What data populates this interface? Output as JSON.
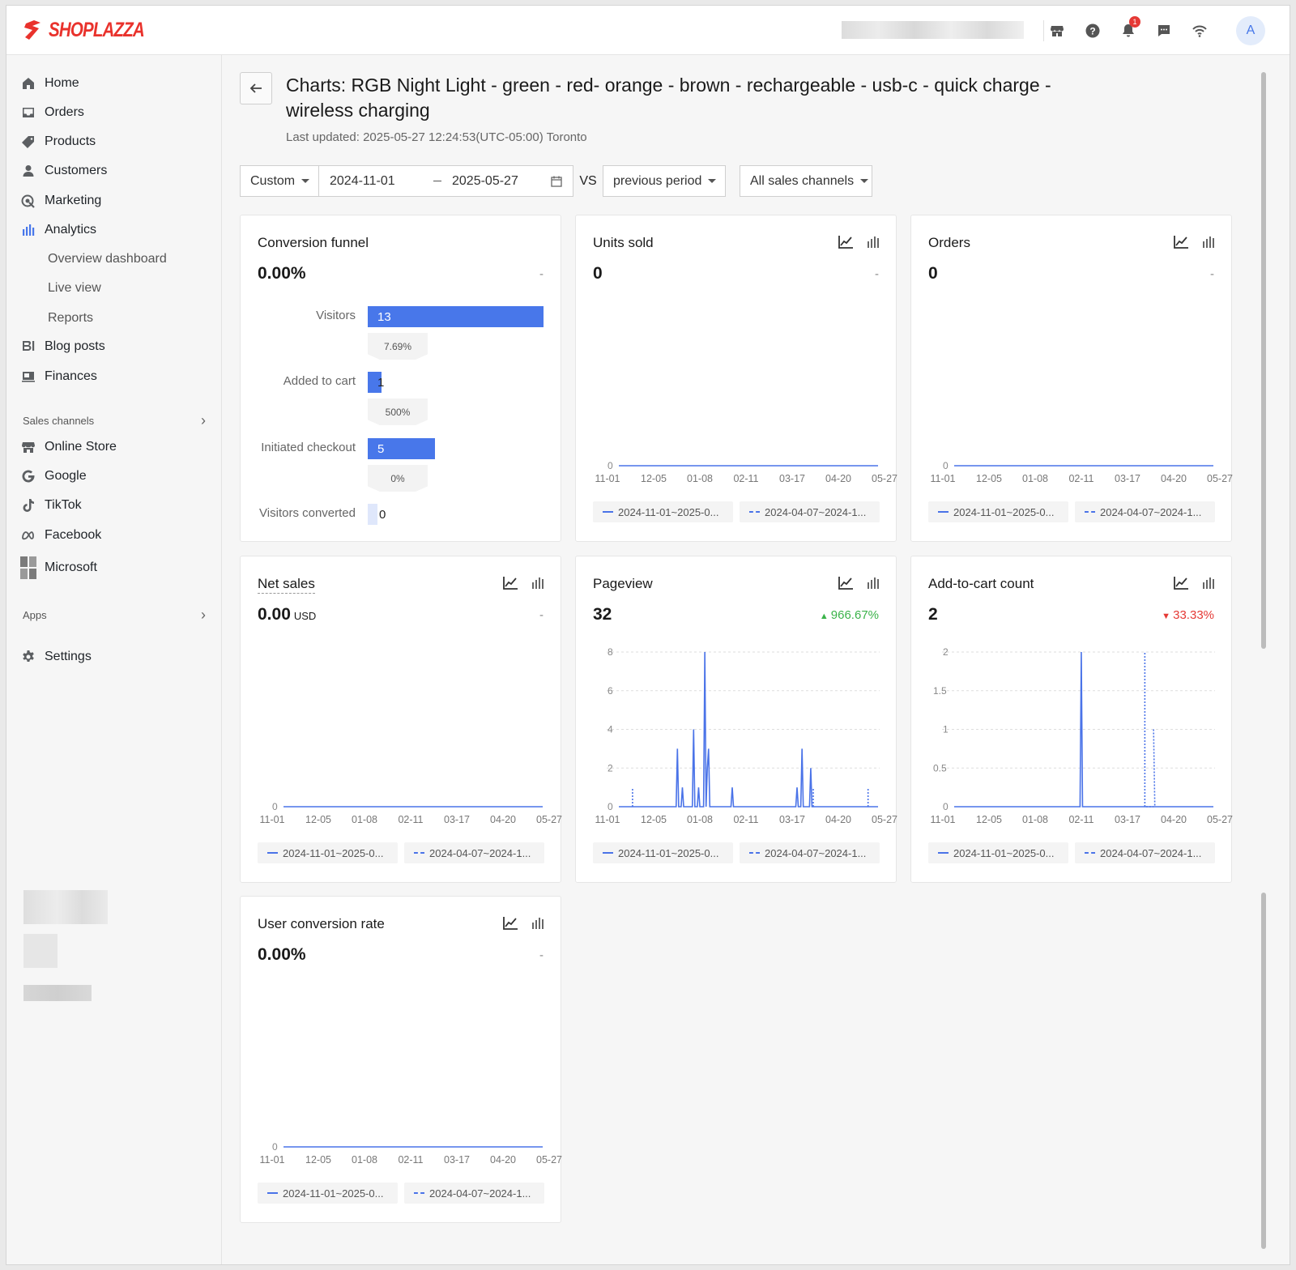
{
  "app": {
    "brand": "SHOPLAZZA",
    "brand_color": "#e9322c",
    "accent": "#4877ea"
  },
  "topbar": {
    "notifications_count": "1",
    "avatar_initial": "A"
  },
  "sidebar": {
    "items": [
      {
        "label": "Home",
        "icon": "home-icon"
      },
      {
        "label": "Orders",
        "icon": "inbox-icon"
      },
      {
        "label": "Products",
        "icon": "tag-icon"
      },
      {
        "label": "Customers",
        "icon": "person-icon"
      },
      {
        "label": "Marketing",
        "icon": "target-icon"
      },
      {
        "label": "Analytics",
        "icon": "bar-chart-icon",
        "active": true
      }
    ],
    "analytics_sub": [
      "Overview dashboard",
      "Live view",
      "Reports"
    ],
    "items2": [
      {
        "label": "Blog posts",
        "icon": "blog-icon"
      },
      {
        "label": "Finances",
        "icon": "wallet-icon"
      }
    ],
    "sales_channels_label": "Sales channels",
    "channels": [
      {
        "label": "Online Store",
        "icon": "store-icon"
      },
      {
        "label": "Google",
        "icon": "google-icon"
      },
      {
        "label": "TikTok",
        "icon": "tiktok-icon"
      },
      {
        "label": "Facebook",
        "icon": "meta-icon"
      },
      {
        "label": "Microsoft",
        "icon": "microsoft-icon"
      }
    ],
    "apps_label": "Apps",
    "settings_label": "Settings"
  },
  "header": {
    "title": "Charts:  RGB Night Light - green - red- orange - brown - rechargeable - usb-c - quick charge - wireless charging",
    "last_updated": "Last updated: 2025-05-27 12:24:53(UTC-05:00) Toronto"
  },
  "filters": {
    "range_type": "Custom",
    "start_date": "2024-11-01",
    "end_date": "2025-05-27",
    "vs_label": "VS",
    "compare": "previous period",
    "channel": "All sales channels"
  },
  "legend": {
    "current": "2024-11-01~2025-0...",
    "previous": "2024-04-07~2024-1..."
  },
  "funnel": {
    "title": "Conversion funnel",
    "value": "0.00%",
    "delta": "-",
    "steps": [
      {
        "label": "Visitors",
        "value": 13
      },
      {
        "label": "Added to cart",
        "value": 1
      },
      {
        "label": "Initiated checkout",
        "value": 5
      },
      {
        "label": "Visitors converted",
        "value": 0
      }
    ],
    "rates": [
      "7.69%",
      "500%",
      "0%"
    ]
  },
  "chart_data": [
    {
      "id": "units",
      "type": "line",
      "title": "Units sold",
      "value": "0",
      "delta": "-",
      "categories": [
        "11-01",
        "12-05",
        "01-08",
        "02-11",
        "03-17",
        "04-20",
        "05-27"
      ],
      "yticks": [
        "0"
      ],
      "ylim": [
        0,
        1
      ],
      "series": [
        {
          "values": [
            [
              0,
              0
            ],
            [
              208,
              0
            ]
          ]
        }
      ]
    },
    {
      "id": "orders",
      "type": "line",
      "title": "Orders",
      "value": "0",
      "delta": "-",
      "categories": [
        "11-01",
        "12-05",
        "01-08",
        "02-11",
        "03-17",
        "04-20",
        "05-27"
      ],
      "yticks": [
        "0"
      ],
      "ylim": [
        0,
        1
      ],
      "series": [
        {
          "values": [
            [
              0,
              0
            ],
            [
              208,
              0
            ]
          ]
        }
      ]
    },
    {
      "id": "netsales",
      "type": "line",
      "title": "Net sales",
      "value": "0.00",
      "unit": "USD",
      "delta": "-",
      "categories": [
        "11-01",
        "12-05",
        "01-08",
        "02-11",
        "03-17",
        "04-20",
        "05-27"
      ],
      "yticks": [
        "0"
      ],
      "ylim": [
        0,
        1
      ],
      "series": [
        {
          "values": [
            [
              0,
              0
            ],
            [
              208,
              0
            ]
          ]
        }
      ]
    },
    {
      "id": "pageview",
      "type": "line",
      "title": "Pageview",
      "value": "32",
      "delta": "966.67%",
      "delta_dir": "up",
      "delta_color": "#3bb34a",
      "categories": [
        "11-01",
        "12-05",
        "01-08",
        "02-11",
        "03-17",
        "04-20",
        "05-27"
      ],
      "yticks": [
        "0",
        "2",
        "4",
        "6",
        "8"
      ],
      "ylim": [
        0,
        8
      ],
      "series": [
        {
          "values": [
            [
              0,
              0
            ],
            [
              46,
              0
            ],
            [
              47,
              3
            ],
            [
              48,
              0
            ],
            [
              50,
              0
            ],
            [
              51,
              1
            ],
            [
              52,
              0
            ],
            [
              59,
              0
            ],
            [
              60,
              4
            ],
            [
              61,
              0
            ],
            [
              63,
              0
            ],
            [
              64,
              1
            ],
            [
              65,
              0
            ],
            [
              68,
              0
            ],
            [
              69,
              8
            ],
            [
              70,
              0
            ],
            [
              71,
              2
            ],
            [
              72,
              3
            ],
            [
              73,
              0
            ],
            [
              90,
              0
            ],
            [
              91,
              1
            ],
            [
              92,
              0
            ],
            [
              142,
              0
            ],
            [
              143,
              1
            ],
            [
              144,
              0
            ],
            [
              146,
              0
            ],
            [
              147,
              3
            ],
            [
              148,
              0
            ],
            [
              153,
              0
            ],
            [
              154,
              2
            ],
            [
              155,
              0
            ],
            [
              208,
              0
            ]
          ]
        },
        {
          "dashed": true,
          "values": [
            [
              11,
              0
            ],
            [
              11,
              1
            ],
            [
              156,
              0
            ],
            [
              156,
              1
            ],
            [
              200,
              0
            ],
            [
              200,
              1
            ]
          ]
        }
      ]
    },
    {
      "id": "addtocart",
      "type": "line",
      "title": "Add-to-cart count",
      "value": "2",
      "delta": "33.33%",
      "delta_dir": "down",
      "delta_color": "#e53935",
      "categories": [
        "11-01",
        "12-05",
        "01-08",
        "02-11",
        "03-17",
        "04-20",
        "05-27"
      ],
      "yticks": [
        "0",
        "0.5",
        "1",
        "1.5",
        "2"
      ],
      "ylim": [
        0,
        2
      ],
      "series": [
        {
          "values": [
            [
              0,
              0
            ],
            [
              101,
              0
            ],
            [
              102,
              2
            ],
            [
              103,
              0
            ],
            [
              208,
              0
            ]
          ]
        },
        {
          "dashed": true,
          "values": [
            [
              153,
              0
            ],
            [
              153,
              2
            ],
            [
              154,
              0
            ],
            [
              160,
              0
            ],
            [
              160,
              1
            ],
            [
              161,
              0
            ]
          ]
        }
      ]
    },
    {
      "id": "ucr",
      "type": "line",
      "title": "User conversion rate",
      "value": "0.00%",
      "delta": "-",
      "categories": [
        "11-01",
        "12-05",
        "01-08",
        "02-11",
        "03-17",
        "04-20",
        "05-27"
      ],
      "yticks": [
        "0"
      ],
      "ylim": [
        0,
        1
      ],
      "series": [
        {
          "values": [
            [
              0,
              0
            ],
            [
              208,
              0
            ]
          ]
        }
      ]
    }
  ]
}
